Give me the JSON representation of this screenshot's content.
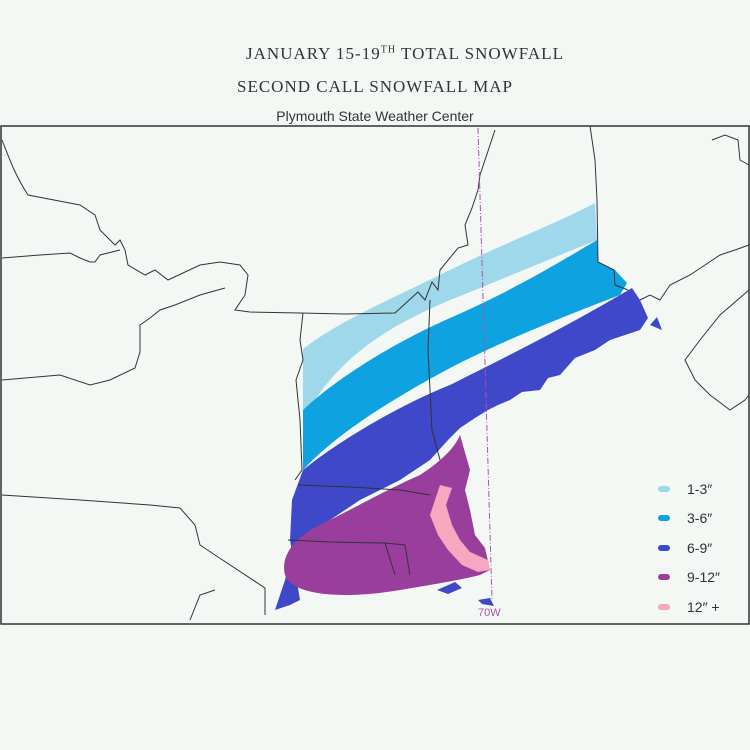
{
  "header": {
    "title_line1_pre": "JANUARY 15-19",
    "title_line1_sup": "TH",
    "title_line1_post": " TOTAL SNOWFALL",
    "title_line2": "SECOND CALL SNOWFALL MAP",
    "credit": "Plymouth State Weather Center"
  },
  "map": {
    "meridian_label": "70W",
    "background_color": "#f3f8f5",
    "border_color": "#333333"
  },
  "legend": {
    "items": [
      {
        "label": "1-3″",
        "color": "#9ed8ea"
      },
      {
        "label": "3-6″",
        "color": "#0ea3e0"
      },
      {
        "label": "6-9″",
        "color": "#3f48c8"
      },
      {
        "label": "9-12″",
        "color": "#9a3e9e"
      },
      {
        "label": "12″ +",
        "color": "#f5a8c0"
      }
    ]
  }
}
